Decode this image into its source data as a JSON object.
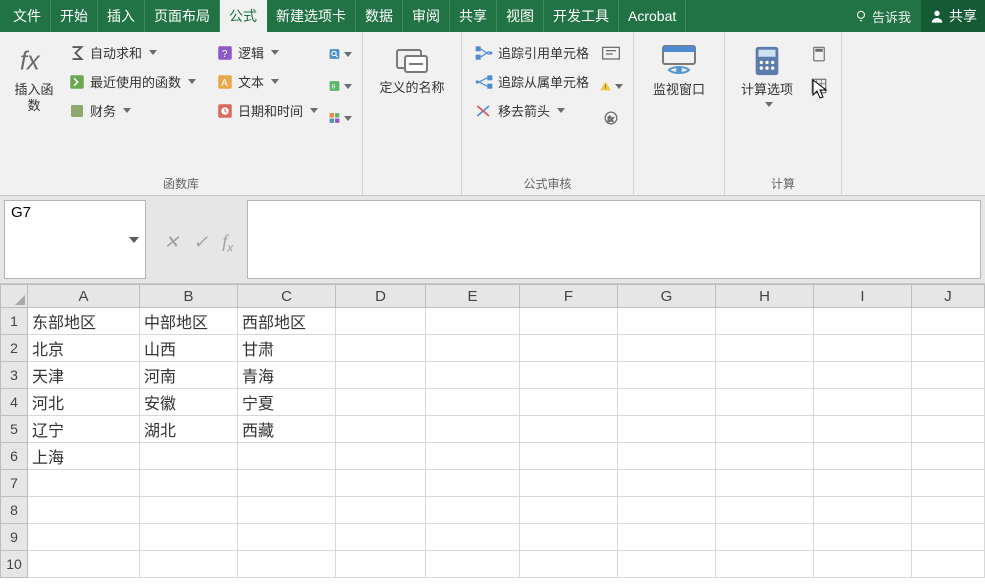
{
  "tabs": [
    "文件",
    "开始",
    "插入",
    "页面布局",
    "公式",
    "新建选项卡",
    "数据",
    "审阅",
    "共享",
    "视图",
    "开发工具",
    "Acrobat"
  ],
  "active_tab_index": 4,
  "tellme": "告诉我",
  "share": "共享",
  "ribbon": {
    "insert_function": "插入函数",
    "autosum": "自动求和",
    "recent": "最近使用的函数",
    "financial": "财务",
    "logical": "逻辑",
    "text": "文本",
    "datetime": "日期和时间",
    "group_library": "函数库",
    "define_name": "定义的名称",
    "trace_precedents": "追踪引用单元格",
    "trace_dependents": "追踪从属单元格",
    "remove_arrows": "移去箭头",
    "group_audit": "公式审核",
    "watch_window": "监视窗口",
    "calc_options": "计算选项",
    "group_calc": "计算"
  },
  "namebox": "G7",
  "columns": [
    "A",
    "B",
    "C",
    "D",
    "E",
    "F",
    "G",
    "H",
    "I",
    "J"
  ],
  "rownums": [
    "1",
    "2",
    "3",
    "4",
    "5",
    "6",
    "7",
    "8",
    "9",
    "10"
  ],
  "cells": {
    "A1": "东部地区",
    "B1": "中部地区",
    "C1": "西部地区",
    "A2": "北京",
    "B2": "山西",
    "C2": "甘肃",
    "A3": "天津",
    "B3": "河南",
    "C3": "青海",
    "A4": "河北",
    "B4": "安徽",
    "C4": "宁夏",
    "A5": "辽宁",
    "B5": "湖北",
    "C5": "西藏",
    "A6": "上海"
  }
}
